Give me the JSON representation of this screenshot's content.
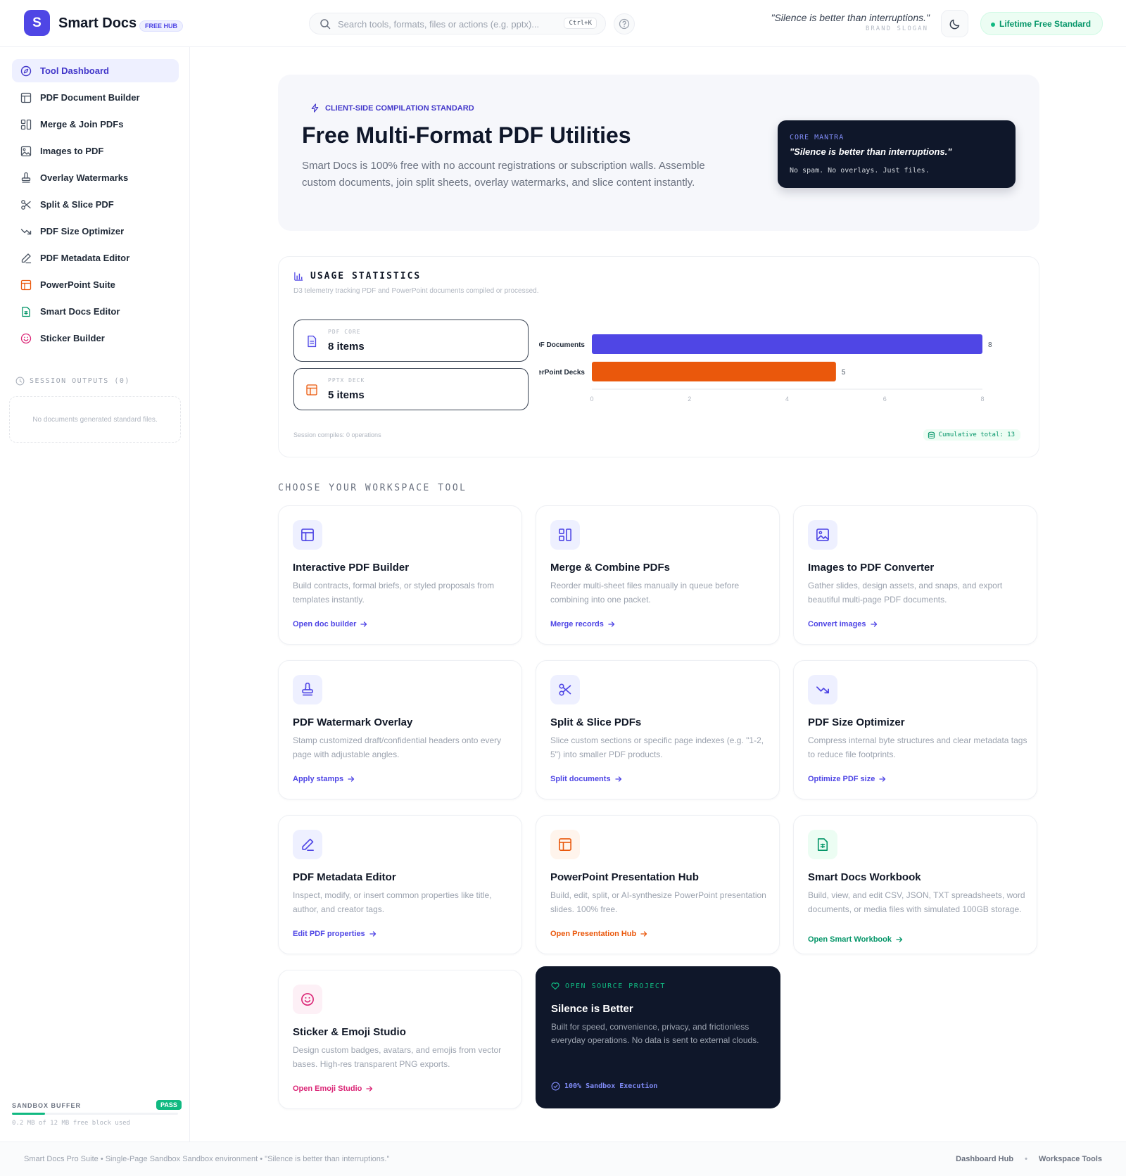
{
  "header": {
    "logo_letter": "S",
    "brand": "Smart Docs",
    "badge": "FREE HUB",
    "search_placeholder": "Search tools, formats, files or actions (e.g. pptx)...",
    "shortcut": "Ctrl+K",
    "slogan": "\"Silence is better than interruptions.\"",
    "slogan_sub": "BRAND SLOGAN",
    "lifetime": "Lifetime Free Standard"
  },
  "sidebar": {
    "items": [
      {
        "label": "Tool Dashboard",
        "icon": "compass-icon"
      },
      {
        "label": "PDF Document Builder",
        "icon": "layout-icon"
      },
      {
        "label": "Merge & Join PDFs",
        "icon": "merge-icon"
      },
      {
        "label": "Images to PDF",
        "icon": "image-icon"
      },
      {
        "label": "Overlay Watermarks",
        "icon": "stamp-icon"
      },
      {
        "label": "Split & Slice PDF",
        "icon": "scissors-icon"
      },
      {
        "label": "PDF Size Optimizer",
        "icon": "trending-down-icon"
      },
      {
        "label": "PDF Metadata Editor",
        "icon": "pen-icon"
      },
      {
        "label": "PowerPoint Suite",
        "icon": "presentation-icon"
      },
      {
        "label": "Smart Docs Editor",
        "icon": "sheet-icon"
      },
      {
        "label": "Sticker Builder",
        "icon": "smile-icon"
      }
    ],
    "session_label": "SESSION OUTPUTS (0)",
    "session_empty": "No documents generated standard files.",
    "sandbox_label": "SANDBOX BUFFER",
    "sandbox_status": "PASS",
    "sandbox_usage": "0.2 MB of 12 MB free block used",
    "sandbox_fraction": 0.2
  },
  "hero": {
    "tag": "CLIENT-SIDE COMPILATION STANDARD",
    "title": "Free Multi-Format PDF Utilities",
    "description": "Smart Docs is 100% free with no account registrations or subscription walls. Assemble custom documents, join split sheets, overlay watermarks, and slice content instantly.",
    "mantra_label": "CORE MANTRA",
    "mantra_quote": "\"Silence is better than interruptions.\"",
    "mantra_sub": "No spam. No overlays. Just files."
  },
  "stats": {
    "title": "USAGE STATISTICS",
    "subtitle": "D3 telemetry tracking PDF and PowerPoint documents compiled or processed.",
    "cards": [
      {
        "label": "PDF CORE",
        "value": "8 items"
      },
      {
        "label": "PPTX DECK",
        "value": "5 items"
      }
    ],
    "footer": "Session compiles: 0 operations",
    "total": "Cumulative total: 13"
  },
  "chart_data": {
    "type": "bar",
    "orientation": "horizontal",
    "categories": [
      "PDF Documents",
      "PowerPoint Decks"
    ],
    "values": [
      8,
      5
    ],
    "colors": [
      "#4f46e5",
      "#ea580c"
    ],
    "xlim": [
      0,
      8
    ],
    "ticks": [
      0,
      2,
      4,
      6,
      8
    ],
    "grid": false
  },
  "section_label": "CHOOSE YOUR WORKSPACE TOOL",
  "cards": [
    {
      "title": "Interactive PDF Builder",
      "desc": "Build contracts, formal briefs, or styled proposals from templates instantly.",
      "link": "Open doc builder",
      "icon": "layout-icon",
      "accent": "#4f46e5",
      "tint": "#eef0ff"
    },
    {
      "title": "Merge & Combine PDFs",
      "desc": "Reorder multi-sheet files manually in queue before combining into one packet.",
      "link": "Merge records",
      "icon": "merge-icon",
      "accent": "#4f46e5",
      "tint": "#eef0ff"
    },
    {
      "title": "Images to PDF Converter",
      "desc": "Gather slides, design assets, and snaps, and export beautiful multi-page PDF documents.",
      "link": "Convert images",
      "icon": "image-icon",
      "accent": "#4f46e5",
      "tint": "#eef0ff"
    },
    {
      "title": "PDF Watermark Overlay",
      "desc": "Stamp customized draft/confidential headers onto every page with adjustable angles.",
      "link": "Apply stamps",
      "icon": "stamp-icon",
      "accent": "#4f46e5",
      "tint": "#eef0ff"
    },
    {
      "title": "Split & Slice PDFs",
      "desc": "Slice custom sections or specific page indexes (e.g. \"1-2, 5\") into smaller PDF products.",
      "link": "Split documents",
      "icon": "scissors-icon",
      "accent": "#4f46e5",
      "tint": "#eef0ff"
    },
    {
      "title": "PDF Size Optimizer",
      "desc": "Compress internal byte structures and clear metadata tags to reduce file footprints.",
      "link": "Optimize PDF size",
      "icon": "trending-down-icon",
      "accent": "#4f46e5",
      "tint": "#eef0ff"
    },
    {
      "title": "PDF Metadata Editor",
      "desc": "Inspect, modify, or insert common properties like title, author, and creator tags.",
      "link": "Edit PDF properties",
      "icon": "pen-icon",
      "accent": "#4f46e5",
      "tint": "#eef0ff"
    },
    {
      "title": "PowerPoint Presentation Hub",
      "desc": "Build, edit, split, or AI-synthesize PowerPoint presentation slides. 100% free.",
      "link": "Open Presentation Hub",
      "icon": "presentation-icon",
      "accent": "#ea580c",
      "tint": "#fff4ec"
    },
    {
      "title": "Smart Docs Workbook",
      "desc": "Build, view, and edit CSV, JSON, TXT spreadsheets, word documents, or media files with simulated 100GB storage.",
      "link": "Open Smart Workbook",
      "icon": "sheet-icon",
      "accent": "#059669",
      "tint": "#ecfdf3"
    },
    {
      "title": "Sticker & Emoji Studio",
      "desc": "Design custom badges, avatars, and emojis from vector bases. High-res transparent PNG exports.",
      "link": "Open Emoji Studio",
      "icon": "smile-icon",
      "accent": "#db2777",
      "tint": "#fdf0f6"
    }
  ],
  "dark_card": {
    "label": "OPEN SOURCE PROJECT",
    "title": "Silence is Better",
    "desc": "Built for speed, convenience, privacy, and frictionless everyday operations. No data is sent to external clouds.",
    "foot": "100% Sandbox Execution"
  },
  "footer": {
    "left": "Smart Docs Pro Suite • Single-Page Sandbox Sandbox environment • \"Silence is better than interruptions.\"",
    "link1": "Dashboard Hub",
    "separator": "•",
    "link2": "Workspace Tools"
  }
}
